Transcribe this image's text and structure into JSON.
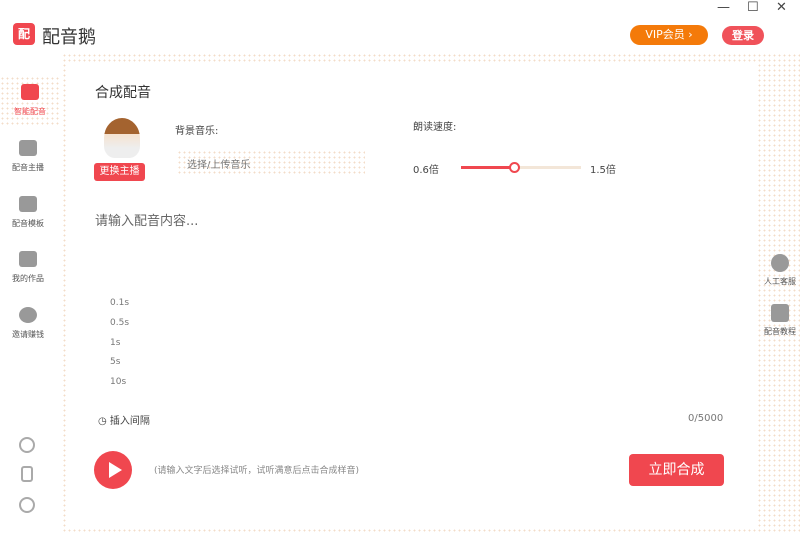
{
  "app": {
    "logo_text": "配",
    "name": "配音鹅"
  },
  "window": {
    "minimize": "—",
    "maximize": "☐",
    "close": "✕"
  },
  "header": {
    "vip": "VIP会员 ›",
    "login": "登录"
  },
  "sidebar": {
    "items": [
      {
        "label": "智能配音",
        "active": true
      },
      {
        "label": "配音主播"
      },
      {
        "label": "配音模板"
      },
      {
        "label": "我的作品"
      },
      {
        "label": "邀请赚钱"
      }
    ]
  },
  "right_panel": {
    "items": [
      {
        "label": "人工客服"
      },
      {
        "label": "配音教程"
      }
    ]
  },
  "main": {
    "title": "合成配音",
    "change_anchor": "更换主播",
    "bg_music_label": "背景音乐:",
    "bg_music_placeholder": "选择/上传音乐",
    "speed_label": "朗读速度:",
    "speed_min": "0.6倍",
    "speed_max": "1.5倍",
    "speed_value": 1.0,
    "content_placeholder": "请输入配音内容...",
    "pauses": [
      "0.1s",
      "0.5s",
      "1s",
      "5s",
      "10s"
    ],
    "insert_pause": "插入间隔",
    "char_count": "0/5000",
    "hint": "(请输入文字后选择试听，试听满意后点击合成样音)",
    "synthesize": "立即合成"
  },
  "colors": {
    "accent": "#f0474f",
    "vip": "#f47a0a"
  }
}
